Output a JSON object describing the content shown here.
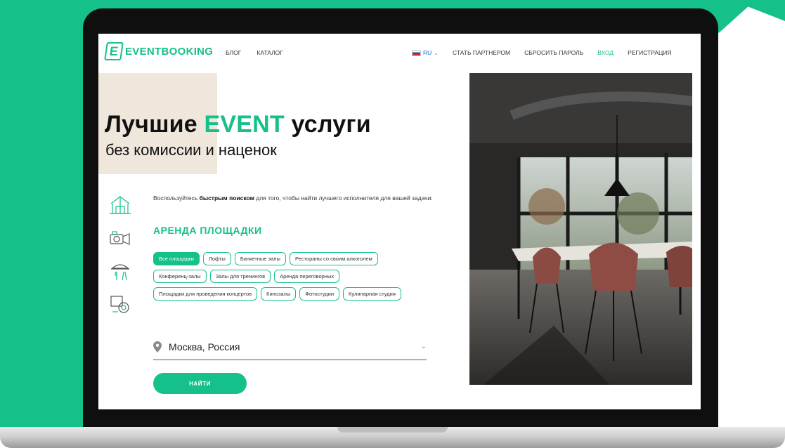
{
  "colors": {
    "accent": "#16c08a",
    "beige": "#efe7dc"
  },
  "logo": {
    "letter": "E",
    "text": "EVENTBOOKING"
  },
  "nav": {
    "left": [
      {
        "label": "БЛОГ"
      },
      {
        "label": "КАТАЛОГ"
      }
    ],
    "language": "RU",
    "right": [
      {
        "label": "СТАТЬ ПАРТНЕРОМ"
      },
      {
        "label": "СБРОСИТЬ ПАРОЛЬ"
      },
      {
        "label": "ВХОД"
      },
      {
        "label": "РЕГИСТРАЦИЯ"
      }
    ]
  },
  "hero": {
    "title_part1": "Лучшие",
    "title_accent": "EVENT",
    "title_part2": "услуги",
    "subtitle": "без комиссии и наценок"
  },
  "side_icons": [
    "venue-tent-icon",
    "camera-equipment-icon",
    "catering-icon",
    "decor-icon"
  ],
  "intro": {
    "before": "Воспользуйтесь",
    "bold": "быстрым поиском",
    "after": "для того, чтобы найти лучшего исполнителя для вашей задачи:"
  },
  "section_title": "АРЕНДА ПЛОЩАДКИ",
  "chips": [
    {
      "label": "Все площадки",
      "active": true
    },
    {
      "label": "Лофты",
      "active": false
    },
    {
      "label": "Банкетные залы",
      "active": false
    },
    {
      "label": "Рестораны со своим алкоголем",
      "active": false
    },
    {
      "label": "Конференц-залы",
      "active": false
    },
    {
      "label": "Залы для тренингов",
      "active": false
    },
    {
      "label": "Аренда переговорных",
      "active": false
    },
    {
      "label": "Площадки для проведения концертов",
      "active": false
    },
    {
      "label": "Кинозалы",
      "active": false
    },
    {
      "label": "Фотостудии",
      "active": false
    },
    {
      "label": "Кулинарная студия",
      "active": false
    }
  ],
  "location": {
    "value": "Москва, Россия"
  },
  "search_button": "НАЙТИ"
}
